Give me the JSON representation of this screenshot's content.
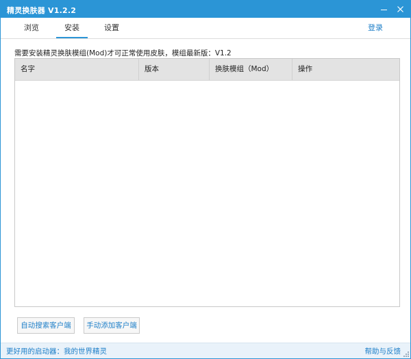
{
  "window": {
    "title": "精灵换肤器 V1.2.2",
    "accent_color": "#2b95d6",
    "minimize_icon": "minimize-icon",
    "close_icon": "close-icon"
  },
  "tabs": [
    {
      "label": "浏览",
      "active": false
    },
    {
      "label": "安装",
      "active": true
    },
    {
      "label": "设置",
      "active": false
    }
  ],
  "header": {
    "login_label": "登录"
  },
  "notice": "需要安装精灵换肤模组(Mod)才可正常使用皮肤，模组最新版：V1.2",
  "table": {
    "columns": [
      "名字",
      "版本",
      "换肤模组（Mod）",
      "操作"
    ],
    "rows": []
  },
  "buttons": {
    "auto_search": "自动搜索客户端",
    "manual_add": "手动添加客户端"
  },
  "statusbar": {
    "prefix": "更好用的启动器：",
    "launcher_link": "我的世界精灵",
    "help_link": "帮助与反馈"
  }
}
